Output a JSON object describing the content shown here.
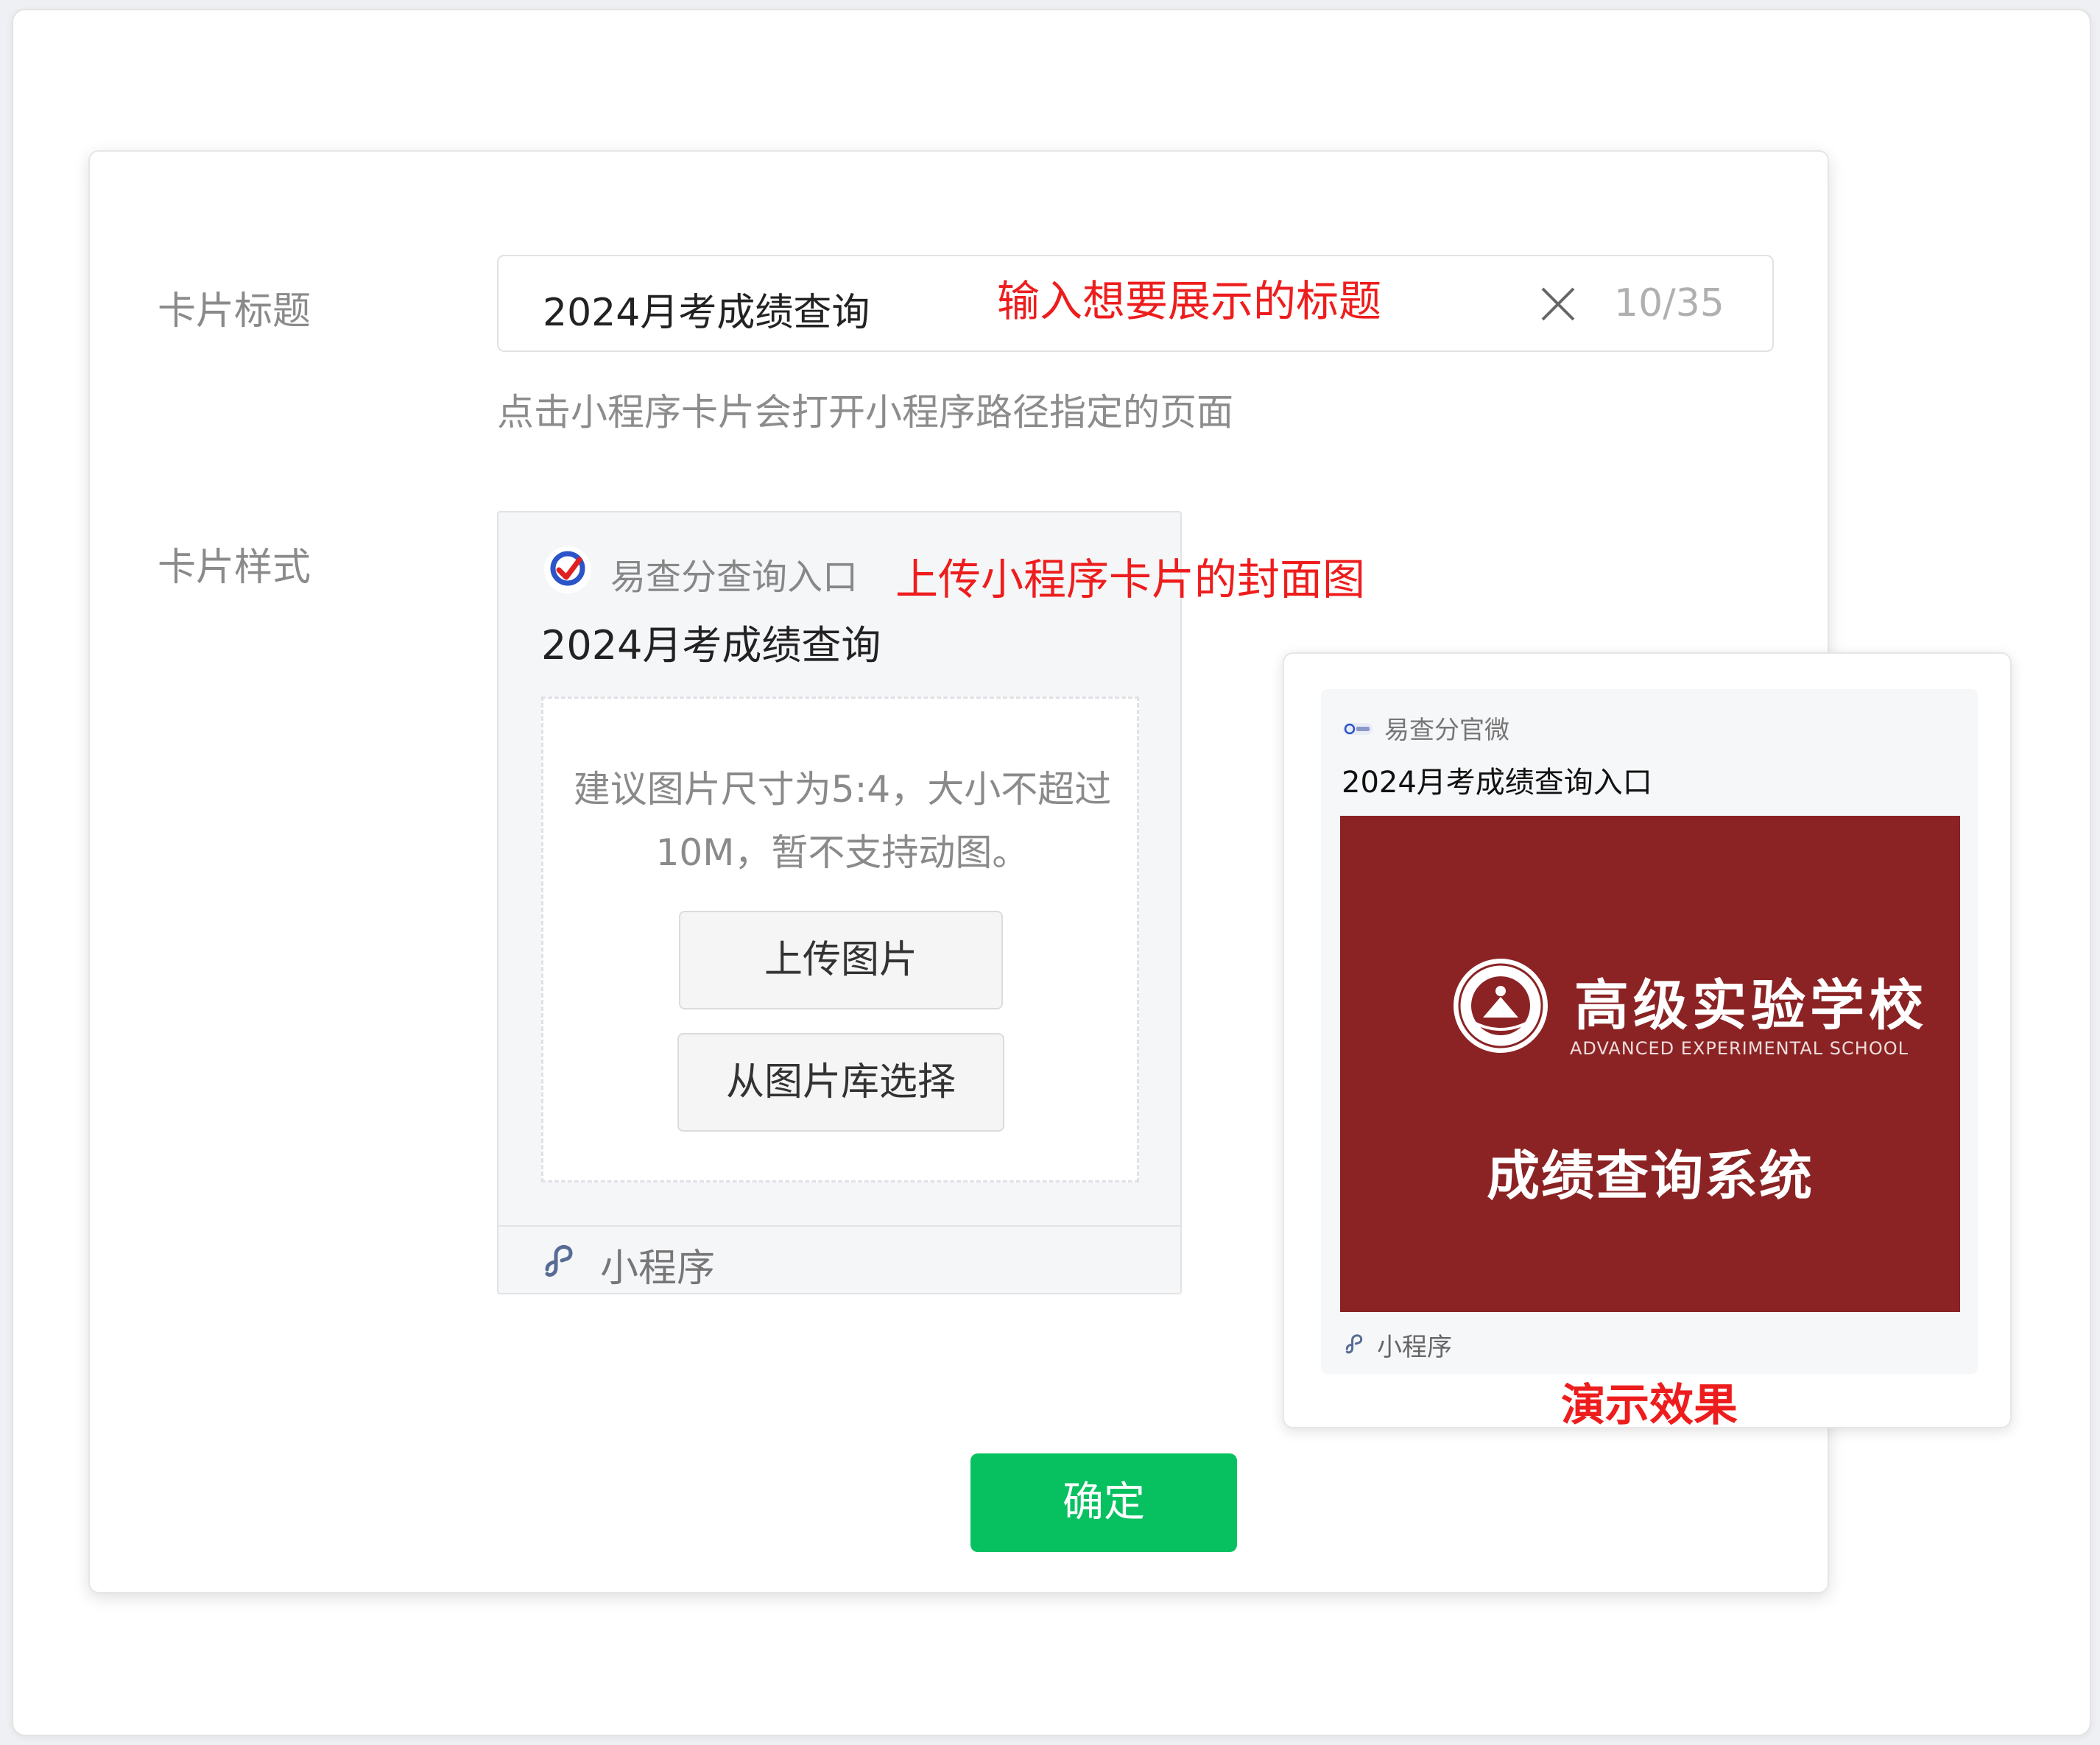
{
  "form": {
    "title_label": "卡片标题",
    "title_value": "2024月考成绩查询",
    "title_counter": "10/35",
    "title_hint": "点击小程序卡片会打开小程序路径指定的页面",
    "style_label": "卡片样式"
  },
  "card_editor": {
    "mp_name": "易查分查询入口",
    "card_title": "2024月考成绩查询",
    "upload_hint": "建议图片尺寸为5:4，大小不超过10M，暂不支持动图。",
    "upload_button": "上传图片",
    "library_button": "从图片库选择",
    "footer_label": "小程序"
  },
  "preview": {
    "mp_name": "易查分官微",
    "card_title": "2024月考成绩查询入口",
    "cover": {
      "school_name": "高级实验学校",
      "school_name_en": "ADVANCED EXPERIMENTAL SCHOOL",
      "title": "成绩查询系统"
    },
    "footer_label": "小程序"
  },
  "annotations": {
    "title_annotation": "输入想要展示的标题",
    "cover_annotation": "上传小程序卡片的封面图",
    "preview_annotation": "演示效果"
  },
  "confirm_button": "确定",
  "colors": {
    "accent_green": "#07c160",
    "annotation_red": "#ee1d1d",
    "cover_red": "#8b2324",
    "link_blue": "#576b95"
  },
  "icons": {
    "clear": "close-icon",
    "mp_logo": "mp-logo-icon",
    "mini_program": "mini-program-link-icon"
  }
}
